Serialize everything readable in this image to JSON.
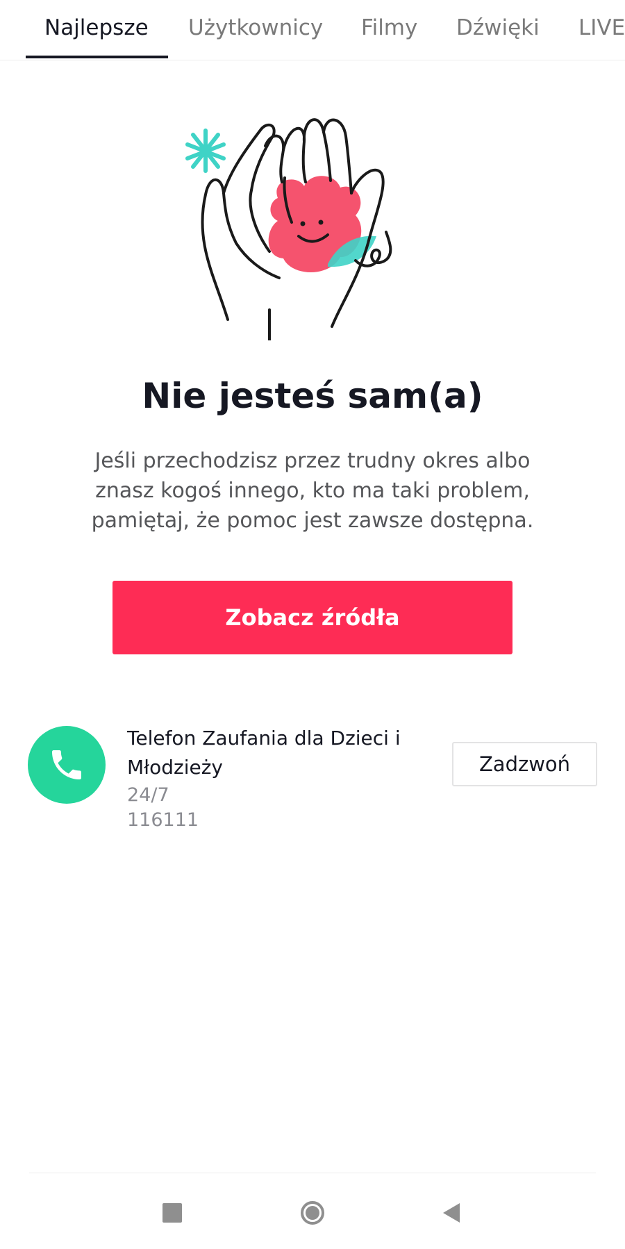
{
  "tabs": [
    {
      "label": "Najlepsze",
      "active": true
    },
    {
      "label": "Użytkownicy",
      "active": false
    },
    {
      "label": "Filmy",
      "active": false
    },
    {
      "label": "Dźwięki",
      "active": false
    },
    {
      "label": "LIVE",
      "active": false
    }
  ],
  "illustration": {
    "icon": "hands-holding-flower-illustration",
    "colors": {
      "flower": "#f5536e",
      "leaf": "#3fd3c6",
      "sparkle": "#3fd3c6",
      "outline": "#1a1a1a"
    }
  },
  "main": {
    "title": "Nie jesteś sam(a)",
    "description": "Jeśli przechodzisz przez trudny okres albo znasz kogoś innego, kto ma taki problem, pamiętaj, że pomoc jest zawsze dostępna.",
    "cta_label": "Zobacz źródła"
  },
  "helpline": {
    "icon": "phone-icon",
    "name": "Telefon Zaufania dla Dzieci i Młodzieży",
    "hours": "24/7",
    "number": "116111",
    "call_label": "Zadzwoń"
  },
  "navbar": {
    "icons": [
      "recents-square-icon",
      "home-circle-icon",
      "back-triangle-icon"
    ]
  },
  "colors": {
    "accent": "#fe2c55",
    "helpline_icon_bg": "#25d59b",
    "text_primary": "#161823",
    "text_secondary": "#8a8b91"
  }
}
